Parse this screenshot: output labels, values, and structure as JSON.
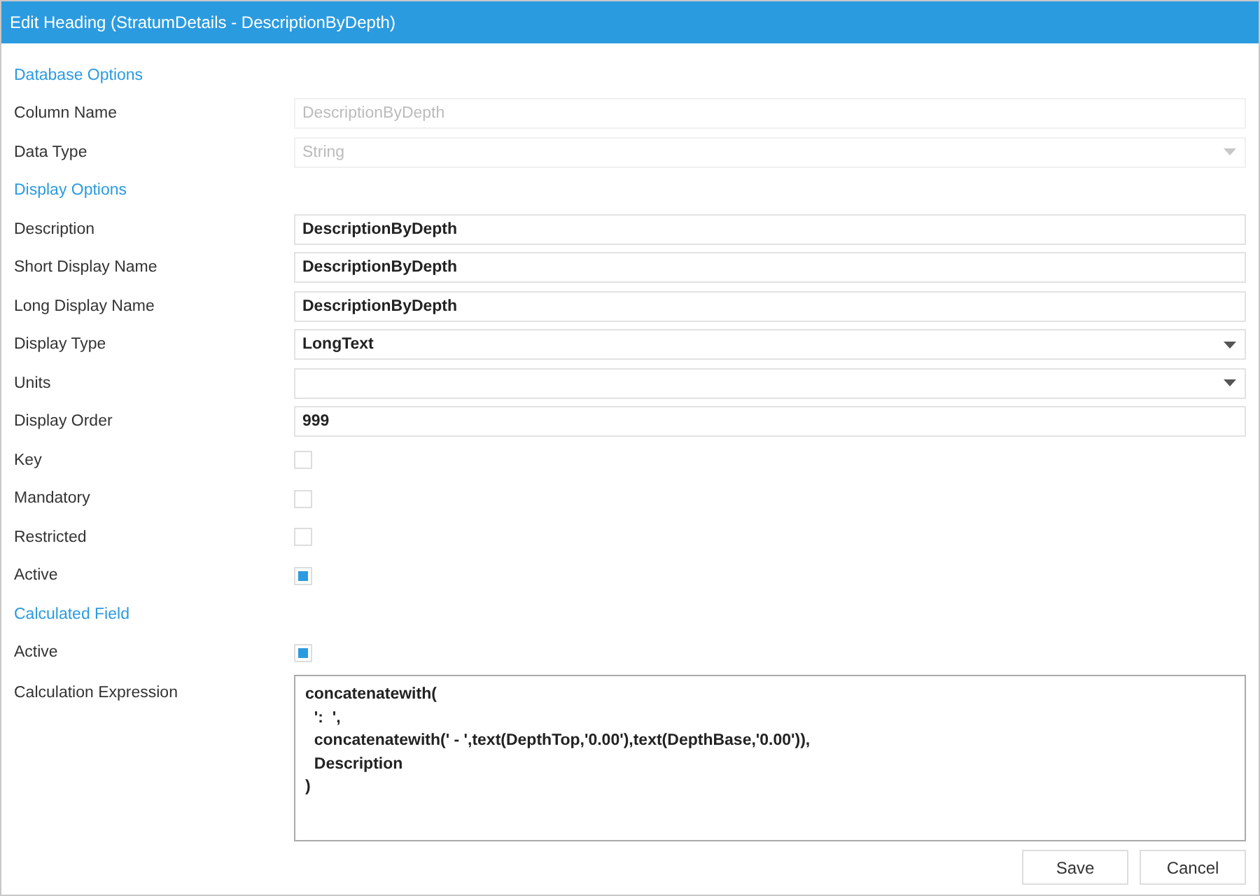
{
  "window": {
    "title": "Edit Heading (StratumDetails - DescriptionByDepth)"
  },
  "rows": [
    {
      "kind": "section",
      "label": "Database Options"
    },
    {
      "kind": "text",
      "label": "Column Name",
      "value": "DescriptionByDepth",
      "disabled": true
    },
    {
      "kind": "dropdown",
      "label": "Data Type",
      "value": "String",
      "disabled": true
    },
    {
      "kind": "section",
      "label": "Display Options"
    },
    {
      "kind": "text",
      "label": "Description",
      "value": "DescriptionByDepth",
      "disabled": false
    },
    {
      "kind": "text",
      "label": "Short Display Name",
      "value": "DescriptionByDepth",
      "disabled": false
    },
    {
      "kind": "text",
      "label": "Long Display Name",
      "value": "DescriptionByDepth",
      "disabled": false
    },
    {
      "kind": "dropdown",
      "label": "Display Type",
      "value": "LongText",
      "disabled": false
    },
    {
      "kind": "dropdown",
      "label": "Units",
      "disabled": false
    },
    {
      "kind": "text",
      "label": "Display Order",
      "value": "999",
      "disabled": false
    },
    {
      "kind": "checkbox",
      "label": "Key",
      "checked": false
    },
    {
      "kind": "checkbox",
      "label": "Mandatory",
      "checked": false
    },
    {
      "kind": "checkbox",
      "label": "Restricted",
      "checked": false
    },
    {
      "kind": "checkbox",
      "label": "Active",
      "checked": true
    },
    {
      "kind": "section",
      "label": "Calculated Field"
    },
    {
      "kind": "checkbox",
      "label": "Active",
      "checked": true
    },
    {
      "kind": "textarea",
      "label": "Calculation Expression",
      "value": "concatenatewith(\n  ':  ',\n  concatenatewith(' - ',text(DepthTop,'0.00'),text(DepthBase,'0.00')),\n  Description\n)"
    }
  ],
  "buttons": [
    "Save",
    "Cancel"
  ]
}
